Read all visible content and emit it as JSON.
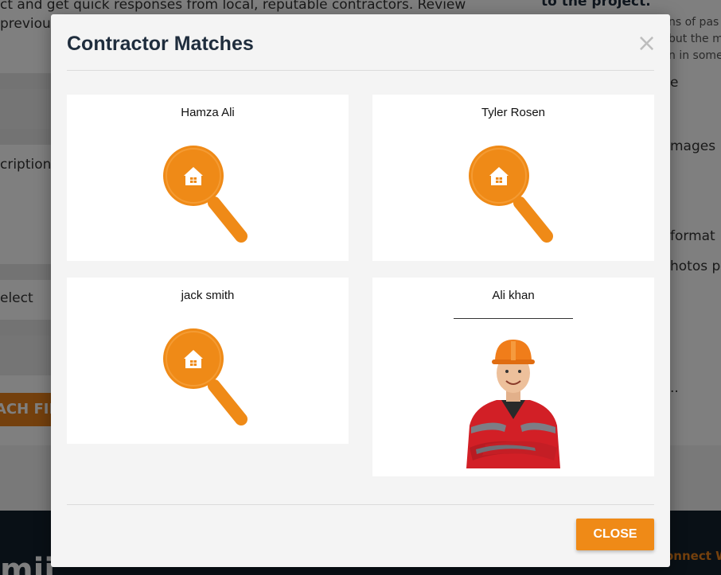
{
  "background": {
    "intro_line_1": "ct and get quick responses from local, reputable contractors. Review",
    "intro_line_2": "previou",
    "label_description": "cription",
    "label_select": "elect",
    "attach_button": "ACH FIL",
    "right_title": "to the project.",
    "right_note_1": "ns of pas",
    "right_note_2": "but the m",
    "right_note_3": "n in some",
    "right_item_1": "e",
    "right_item_2": "mages",
    "right_item_3": "format",
    "right_item_4": "hotos pe",
    "right_item_5": "..",
    "footer_connect": "onnect W",
    "footer_logo": "mii"
  },
  "modal": {
    "title": "Contractor Matches",
    "close_x": "×",
    "close_button": "CLOSE",
    "contractors": [
      {
        "name": "Hamza Ali",
        "image": "search-home-icon"
      },
      {
        "name": "Tyler Rosen",
        "image": "search-home-icon"
      },
      {
        "name": "jack smith",
        "image": "search-home-icon"
      },
      {
        "name": "Ali khan",
        "image": "worker-photo"
      }
    ]
  },
  "colors": {
    "accent": "#ef8a17",
    "title": "#1f2d3d",
    "footer": "#13212c",
    "modal_bg": "#f4f4f4"
  }
}
